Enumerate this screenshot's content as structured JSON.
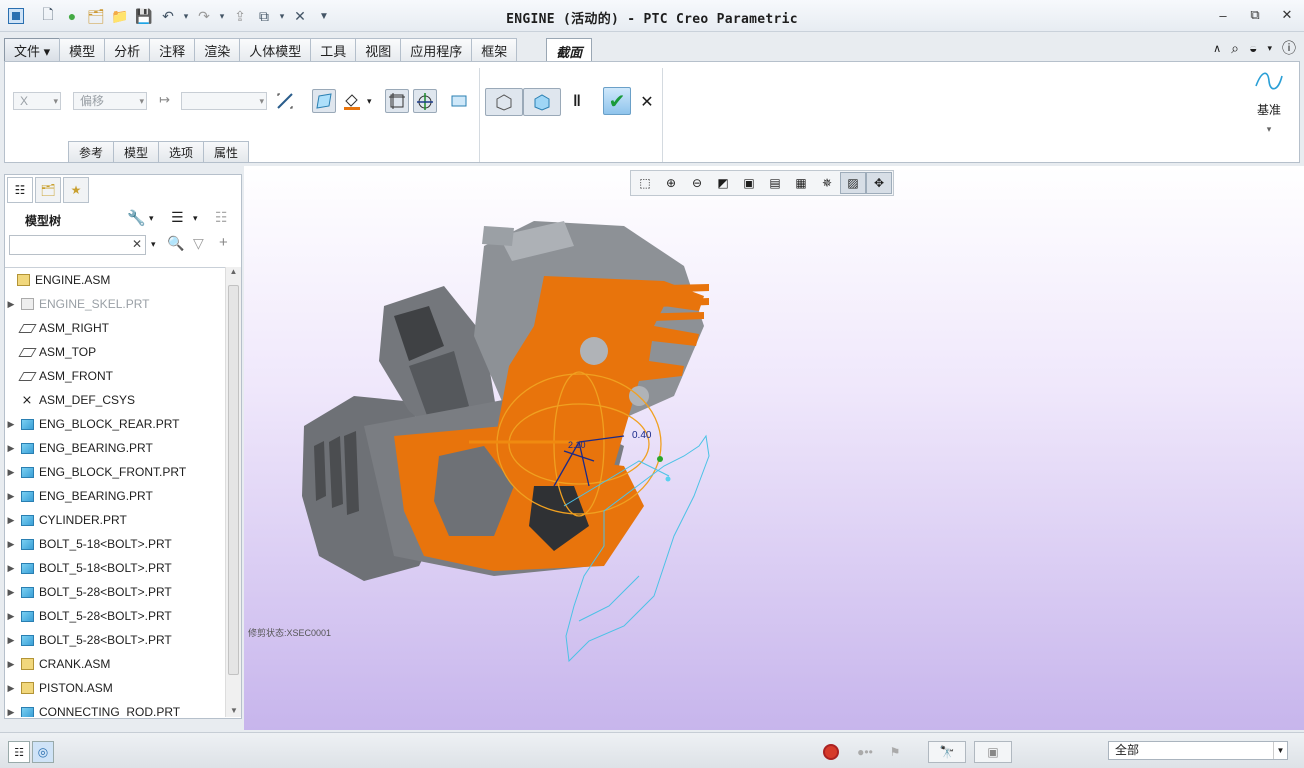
{
  "window": {
    "title": "ENGINE (活动的) - PTC Creo Parametric"
  },
  "ribbon_tabs": [
    {
      "label": "文件 ▾"
    },
    {
      "label": "模型"
    },
    {
      "label": "分析"
    },
    {
      "label": "注释"
    },
    {
      "label": "渲染"
    },
    {
      "label": "人体模型"
    },
    {
      "label": "工具"
    },
    {
      "label": "视图"
    },
    {
      "label": "应用程序"
    },
    {
      "label": "框架"
    },
    {
      "label": "截面"
    }
  ],
  "section_tab": {
    "axis_value": "X",
    "offset_value": "偏移",
    "distance_value": "",
    "subtabs": [
      "参考",
      "模型",
      "选项",
      "属性"
    ],
    "basis_label": "基准"
  },
  "model_tree": {
    "title": "模型树",
    "search_value": "",
    "items": [
      {
        "label": "ENGINE.ASM",
        "icon": "asm",
        "expand": ""
      },
      {
        "label": "ENGINE_SKEL.PRT",
        "icon": "skel",
        "expand": "▶"
      },
      {
        "label": "ASM_RIGHT",
        "icon": "plane",
        "expand": ""
      },
      {
        "label": "ASM_TOP",
        "icon": "plane",
        "expand": ""
      },
      {
        "label": "ASM_FRONT",
        "icon": "plane",
        "expand": ""
      },
      {
        "label": "ASM_DEF_CSYS",
        "icon": "csys",
        "expand": ""
      },
      {
        "label": "ENG_BLOCK_REAR.PRT",
        "icon": "part",
        "expand": "▶"
      },
      {
        "label": "ENG_BEARING.PRT",
        "icon": "part",
        "expand": "▶"
      },
      {
        "label": "ENG_BLOCK_FRONT.PRT",
        "icon": "part",
        "expand": "▶"
      },
      {
        "label": "ENG_BEARING.PRT",
        "icon": "part",
        "expand": "▶"
      },
      {
        "label": "CYLINDER.PRT",
        "icon": "part",
        "expand": "▶"
      },
      {
        "label": "BOLT_5-18<BOLT>.PRT",
        "icon": "part",
        "expand": "▶"
      },
      {
        "label": "BOLT_5-18<BOLT>.PRT",
        "icon": "part",
        "expand": "▶"
      },
      {
        "label": "BOLT_5-28<BOLT>.PRT",
        "icon": "part",
        "expand": "▶"
      },
      {
        "label": "BOLT_5-28<BOLT>.PRT",
        "icon": "part",
        "expand": "▶"
      },
      {
        "label": "BOLT_5-28<BOLT>.PRT",
        "icon": "part",
        "expand": "▶"
      },
      {
        "label": "CRANK.ASM",
        "icon": "asm",
        "expand": "▶"
      },
      {
        "label": "PISTON.ASM",
        "icon": "asm",
        "expand": "▶"
      },
      {
        "label": "CONNECTING_ROD.PRT",
        "icon": "part",
        "expand": "▶"
      }
    ]
  },
  "graphics": {
    "dimension_value": "0.40",
    "small_value": "2.10",
    "clip_status": "修剪状态:XSEC0001"
  },
  "status_bar": {
    "filter_value": "全部"
  },
  "colors": {
    "section_orange": "#e8740c",
    "accent_blue": "#3a9fd6",
    "bg_purple": "#c7b5ec"
  }
}
